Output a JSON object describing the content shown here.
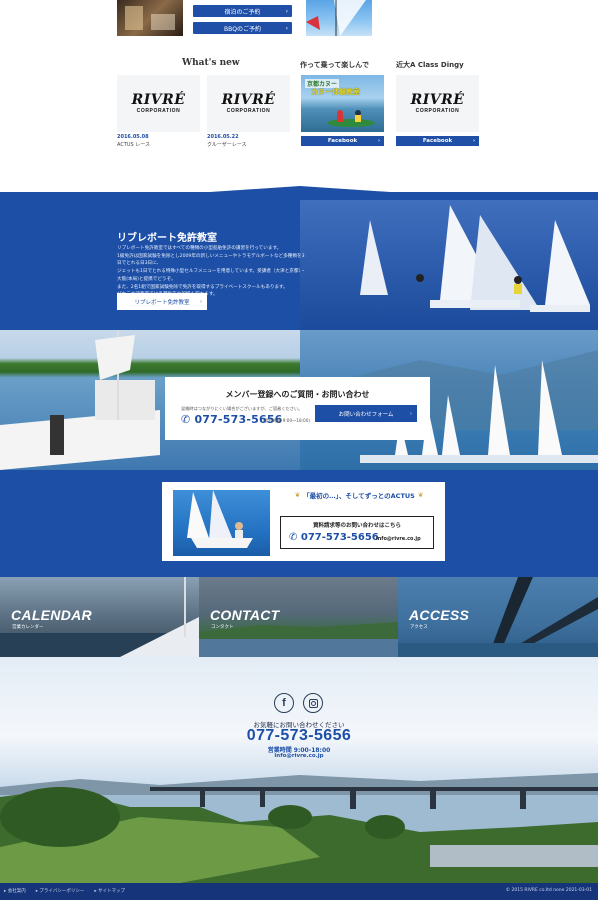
{
  "top": {
    "buttons": [
      {
        "label": "宿泊のご予約"
      },
      {
        "label": "BBQのご予約"
      }
    ]
  },
  "news": {
    "headers": {
      "whats_new": "What's new",
      "tsukutte": "作って乗って楽しんで",
      "kinki": "近大A Class Dingy"
    },
    "logo": {
      "main": "RIVRÉ",
      "sub": "CORPORATION"
    },
    "items": [
      {
        "date": "2016.05.08",
        "text": "ACTUS レース"
      },
      {
        "date": "2016.05.22",
        "text": "クルーザーレース"
      }
    ],
    "banner": {
      "line1": "京都カヌー",
      "line2": "カヌー体験教室"
    },
    "facebook_label": "Facebook"
  },
  "school": {
    "title": "リブレボート免許教室",
    "body": [
      "リブレボート免許教室ではすべての種類の小型船舶免許の講習を行っています。",
      "1級免許は国家試験を免除とし2009年の新しいメニューやトラモデルボートなど多種類を3日でとれる日3日に、",
      "ジェットも1日でとれる特殊小型セルフメニューを用意しています。受講者（大津と京都）・大阪(本局)と提携でどうぞ。",
      "また、2名1組で国家試験免除で免許を取得するプライベートスクールもあります。",
      "びわこ大津教室では各種免許や船特も取れます。"
    ],
    "button_label": "リブレボート免許教室"
  },
  "contact": {
    "title": "メンバー登録へのご質問・お問い合わせ",
    "note": "混雑時はつながりにくい場合がございますが、ご容赦ください。",
    "phone": "077-573-5656",
    "hours": "(受付時間 9:00～18:00)",
    "form_label": "お問い合わせフォーム"
  },
  "actus": {
    "tagline": "「最初の…」、そしてずっとのACTUS",
    "inquiry": "資料請求等のお問い合わせはこちら",
    "phone": "077-573-5656",
    "email": "info@rivre.co.jp"
  },
  "tiles": [
    {
      "title": "CALENDAR",
      "sub": "営業カレンダー"
    },
    {
      "title": "CONTACT",
      "sub": "コンタクト"
    },
    {
      "title": "ACCESS",
      "sub": "アクセス"
    }
  ],
  "footer": {
    "ask": "お気軽にお問い合わせください",
    "phone": "077-573-5656",
    "hours": "営業時間 9:00-18:00",
    "email": "info@rivre.co.jp",
    "links": [
      "会社案内",
      "プライバシーポリシー",
      "サイトマップ"
    ],
    "copyright": "© 2015 RIVRE co.ltd  none 2021-03-01"
  },
  "colors": {
    "brand": "#1d4fa6",
    "dark_blue": "#16347a",
    "gold": "#c9a43b"
  }
}
